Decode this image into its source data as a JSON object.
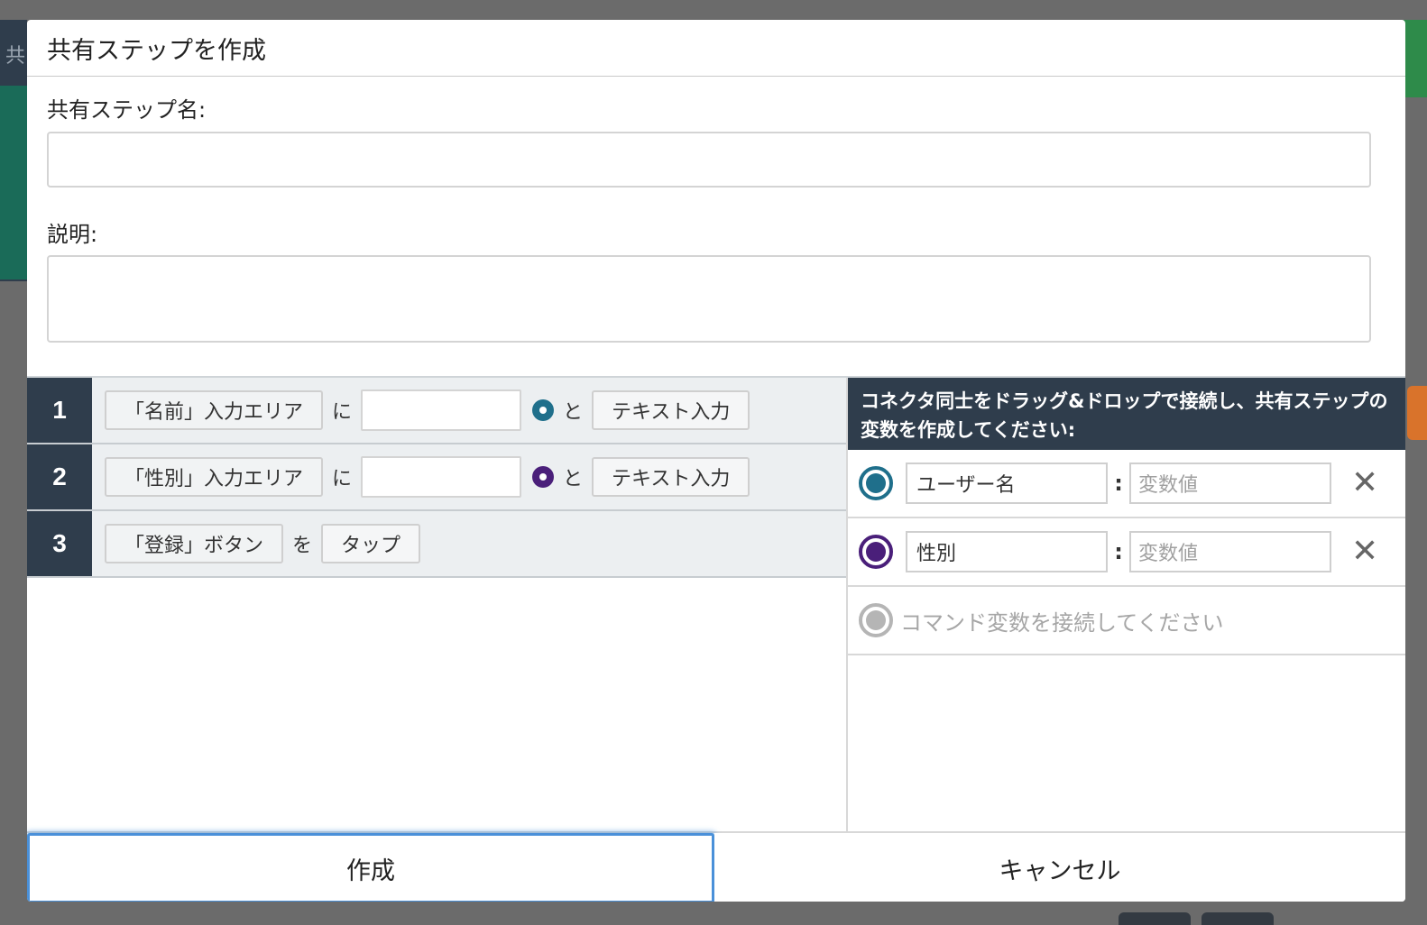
{
  "background": {
    "left_label": "共"
  },
  "modal": {
    "title": "共有ステップを作成",
    "name_label": "共有ステップ名:",
    "name_value": "",
    "description_label": "説明:",
    "description_value": ""
  },
  "steps": [
    {
      "number": "1",
      "target": "「名前」入力エリア",
      "particle": "に",
      "value": "",
      "dot_color": "#1f6f8b",
      "conj": "と",
      "command": "テキスト入力"
    },
    {
      "number": "2",
      "target": "「性別」入力エリア",
      "particle": "に",
      "value": "",
      "dot_color": "#4a1f7a",
      "conj": "と",
      "command": "テキスト入力"
    },
    {
      "number": "3",
      "target": "「登録」ボタン",
      "particle": "を",
      "command": "タップ"
    }
  ],
  "variables": {
    "instruction": "コネクタ同士をドラッグ&ドロップで接続し、共有ステップの変数を作成してください:",
    "items": [
      {
        "name": "ユーザー名",
        "separator": ":",
        "value_placeholder": "変数値",
        "color": "#1f6f8b"
      },
      {
        "name": "性別",
        "separator": ":",
        "value_placeholder": "変数値",
        "color": "#4a1f7a"
      }
    ],
    "empty_prompt": "コマンド変数を接続してください",
    "empty_color": "#b5b5b5",
    "remove_symbol": "✕"
  },
  "footer": {
    "create_label": "作成",
    "cancel_label": "キャンセル"
  }
}
